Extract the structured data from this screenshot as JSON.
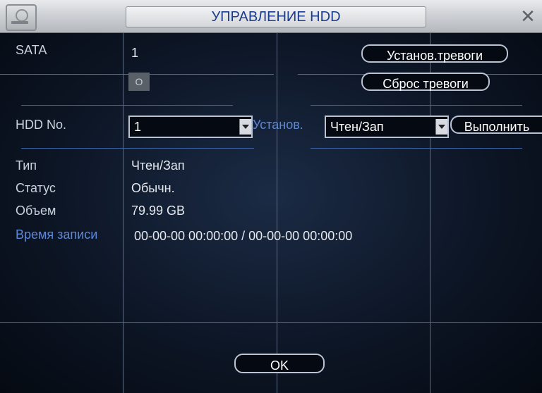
{
  "window": {
    "title": "УПРАВЛЕНИЕ HDD",
    "close_glyph": "✕"
  },
  "sata": {
    "label": "SATA",
    "value": "1",
    "indicator": "O"
  },
  "alarm": {
    "set_button": "Установ.тревоги",
    "reset_button": "Сброс тревоги"
  },
  "hdd": {
    "label": "HDD No.",
    "selected": "1",
    "set_label": "Установ.",
    "mode_selected": "Чтен/Зап",
    "execute_button": "Выполнить"
  },
  "info": {
    "type_label": "Тип",
    "type_value": "Чтен/Зап",
    "status_label": "Статус",
    "status_value": "Обычн.",
    "capacity_label": "Объем",
    "capacity_value": "79.99 GB",
    "rec_time_label": "Время записи",
    "rec_time_value": "00-00-00 00:00:00 / 00-00-00 00:00:00"
  },
  "footer": {
    "ok_button": "OK"
  }
}
